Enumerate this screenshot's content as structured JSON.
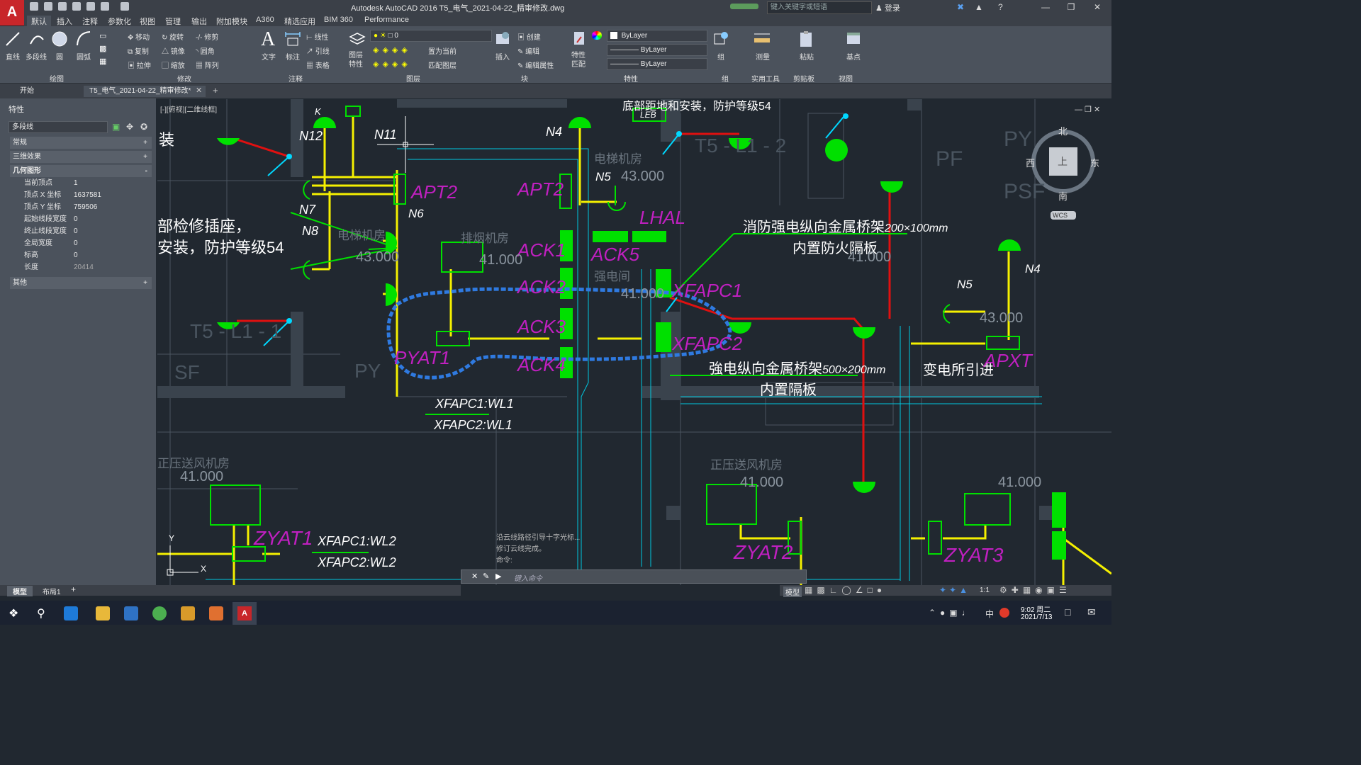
{
  "app": {
    "title": "Autodesk AutoCAD 2016    T5_电气_2021-04-22_精审修改.dwg",
    "search_placeholder": "键入关键字或短语",
    "login": "登录"
  },
  "ribbon_tabs": [
    "默认",
    "插入",
    "注释",
    "参数化",
    "视图",
    "管理",
    "输出",
    "附加模块",
    "A360",
    "精选应用",
    "BIM 360",
    "Performance"
  ],
  "ribbon": {
    "draw": {
      "title": "绘图",
      "line": "直线",
      "polyline": "多段线",
      "circle": "圆",
      "arc": "圆弧"
    },
    "modify": {
      "title": "修改",
      "move": "移动",
      "rotate": "旋转",
      "trim": "修剪",
      "copy": "复制",
      "mirror": "镜像",
      "fillet": "圆角",
      "stretch": "拉伸",
      "scale": "缩放",
      "array": "阵列"
    },
    "annotation": {
      "title": "注释",
      "text": "文字",
      "dimension": "标注",
      "linear": "线性",
      "leader": "引线",
      "table": "表格"
    },
    "layers": {
      "title": "图层",
      "layer_props": "图层特性",
      "current_layer": "0",
      "set_current": "置为当前",
      "match_layer": "匹配图层"
    },
    "block": {
      "title": "块",
      "insert": "插入",
      "create": "创建",
      "edit": "编辑",
      "edit_attr": "编辑属性"
    },
    "properties": {
      "title": "特性",
      "match": "特性匹配",
      "color": "ByLayer",
      "linetype": "ByLayer",
      "lineweight": "ByLayer"
    },
    "groups": {
      "title": "组",
      "group": "组"
    },
    "utilities": {
      "title": "实用工具",
      "measure": "测量"
    },
    "clipboard": {
      "title": "剪贴板",
      "paste": "粘贴"
    },
    "view": {
      "title": "视图",
      "base": "基点"
    }
  },
  "doc_tabs": [
    "开始",
    "T5_电气_2021-04-22_精审修改*"
  ],
  "properties_panel": {
    "title": "特性",
    "object_type": "多段线",
    "sections": [
      "常规",
      "三维效果",
      "几何图形",
      "其他"
    ],
    "rows": [
      {
        "label": "当前顶点",
        "value": "1"
      },
      {
        "label": "顶点 X 坐标",
        "value": "1637581"
      },
      {
        "label": "顶点 Y 坐标",
        "value": "759506"
      },
      {
        "label": "起始线段宽度",
        "value": "0"
      },
      {
        "label": "终止线段宽度",
        "value": "0"
      },
      {
        "label": "全局宽度",
        "value": "0"
      },
      {
        "label": "标高",
        "value": "0"
      },
      {
        "label": "长度",
        "value": "20414"
      }
    ]
  },
  "viewport_label": "[-][俯视][二维线框]",
  "viewcube": {
    "north": "北",
    "south": "南",
    "east": "东",
    "west": "西",
    "top": "上",
    "wcs": "WCS"
  },
  "drawing_text": {
    "apt2a": "APT2",
    "apt2b": "APT2",
    "ack1": "ACK1",
    "ack2": "ACK2",
    "ack3": "ACK3",
    "ack4": "ACK4",
    "ack5": "ACK5",
    "lhal": "LHAL",
    "xfapc1": "XFAPC1",
    "xfapc2": "XFAPC2",
    "pyat1": "PYAT1",
    "zyat1": "ZYAT1",
    "zyat2": "ZYAT2",
    "zyat3": "ZYAT3",
    "apxt": "APXT",
    "n12": "N12",
    "n11": "N11",
    "n7": "N7",
    "n8": "N8",
    "n6": "N6",
    "n4a": "N4",
    "n5a": "N5",
    "n4b": "N4",
    "n5b": "N5",
    "k": "K",
    "leb": "LEB",
    "elev1": "43.000",
    "elev2": "41.000",
    "elev3": "43.000",
    "elev4": "41.000",
    "elev5": "41.000",
    "elev6": "41.000",
    "elev7": "41.000",
    "elev8": "43.000",
    "elev9": "41.000",
    "fire_tray": "消防强电纵向金属桥架",
    "fire_tray_size": "200×100mm",
    "fire_tray_sub": "内置防火隔板",
    "power_tray": "強电纵向金属桥架",
    "power_tray_size": "500×200mm",
    "power_tray_sub": "内置隔板",
    "substation": "变电所引进",
    "wl1a": "XFAPC1:WL1",
    "wl1b": "XFAPC2:WL1",
    "wl2a": "XFAPC1:WL2",
    "wl2b": "XFAPC2:WL2",
    "left_note1": "装",
    "left_note2": "部检修插座，",
    "left_note3": "安装，防护等级54",
    "top_note": "底部距地和安装，防护等级54",
    "room1": "电梯机房",
    "room2": "排烟机房",
    "room3": "强电间",
    "room4": "正压送风机房",
    "room5": "正压送风机房",
    "room6": "电梯机房",
    "t5_1": "T5 - L1 - 2",
    "t5_2": "T5 - L1 - 1",
    "sf": "SF",
    "py": "PY",
    "pf": "PF",
    "psf": "PSF",
    "py2": "PY"
  },
  "command": {
    "history": [
      "沿云线路径引导十字光标...",
      "修订云线完成。",
      "命令:"
    ],
    "placeholder": "键入命令"
  },
  "layout_tabs": [
    "模型",
    "布局1"
  ],
  "status": {
    "model": "模型",
    "scale": "1:1"
  },
  "taskbar": {
    "time": "9:02 周二",
    "date": "2021/7/13",
    "ime": "中"
  },
  "colors": {
    "yellow": "#f5f000",
    "green": "#00e000",
    "cyan": "#00c8e0",
    "magenta": "#c020c0",
    "red": "#e01010",
    "cloud": "#2f7ae0",
    "bg": "#212830"
  }
}
